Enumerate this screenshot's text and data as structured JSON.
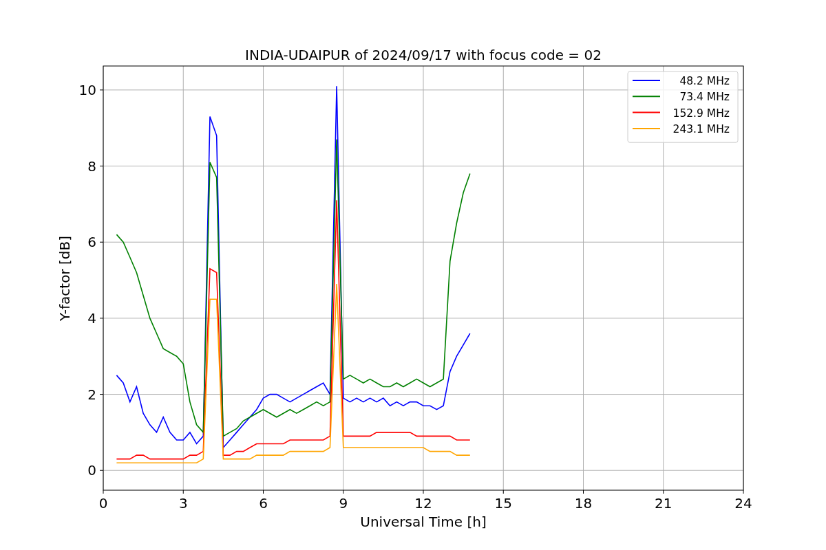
{
  "figure": {
    "chart_data": {
      "type": "line",
      "title": "INDIA-UDAIPUR of 2024/09/17 with focus code = 02",
      "xlabel": "Universal Time [h]",
      "ylabel": "Y-factor [dB]",
      "x": [
        0.5,
        0.75,
        1,
        1.25,
        1.5,
        1.75,
        2,
        2.25,
        2.5,
        2.75,
        3,
        3.25,
        3.5,
        3.75,
        4,
        4.25,
        4.5,
        4.75,
        5,
        5.25,
        5.5,
        5.75,
        6,
        6.25,
        6.5,
        6.75,
        7,
        7.25,
        7.5,
        7.75,
        8,
        8.25,
        8.5,
        8.75,
        9,
        9.25,
        9.5,
        9.75,
        10,
        10.25,
        10.5,
        10.75,
        11,
        11.25,
        11.5,
        11.75,
        12,
        12.25,
        12.5,
        12.75,
        13,
        13.25,
        13.5,
        13.75
      ],
      "series": [
        {
          "name": "48.2 MHz",
          "color": "#0000ff",
          "values": [
            2.5,
            2.3,
            1.8,
            2.2,
            1.5,
            1.2,
            1.0,
            1.4,
            1.0,
            0.8,
            0.8,
            1.0,
            0.7,
            0.9,
            9.3,
            8.8,
            0.6,
            0.8,
            1.0,
            1.2,
            1.4,
            1.6,
            1.9,
            2.0,
            2.0,
            1.9,
            1.8,
            1.9,
            2.0,
            2.1,
            2.2,
            2.3,
            2.0,
            10.1,
            1.9,
            1.8,
            1.9,
            1.8,
            1.9,
            1.8,
            1.9,
            1.7,
            1.8,
            1.7,
            1.8,
            1.8,
            1.7,
            1.7,
            1.6,
            1.7,
            2.6,
            3.0,
            3.3,
            3.6
          ]
        },
        {
          "name": "73.4 MHz",
          "color": "#008000",
          "values": [
            6.2,
            6.0,
            5.6,
            5.2,
            4.6,
            4.0,
            3.6,
            3.2,
            3.1,
            3.0,
            2.8,
            1.8,
            1.2,
            1.0,
            8.1,
            7.7,
            0.9,
            1.0,
            1.1,
            1.3,
            1.4,
            1.5,
            1.6,
            1.5,
            1.4,
            1.5,
            1.6,
            1.5,
            1.6,
            1.7,
            1.8,
            1.7,
            1.8,
            8.7,
            2.4,
            2.5,
            2.4,
            2.3,
            2.4,
            2.3,
            2.2,
            2.2,
            2.3,
            2.2,
            2.3,
            2.4,
            2.3,
            2.2,
            2.3,
            2.4,
            5.5,
            6.5,
            7.3,
            7.8
          ]
        },
        {
          "name": "152.9 MHz",
          "color": "#ff0000",
          "values": [
            0.3,
            0.3,
            0.3,
            0.4,
            0.4,
            0.3,
            0.3,
            0.3,
            0.3,
            0.3,
            0.3,
            0.4,
            0.4,
            0.5,
            5.3,
            5.2,
            0.4,
            0.4,
            0.5,
            0.5,
            0.6,
            0.7,
            0.7,
            0.7,
            0.7,
            0.7,
            0.8,
            0.8,
            0.8,
            0.8,
            0.8,
            0.8,
            0.9,
            7.1,
            0.9,
            0.9,
            0.9,
            0.9,
            0.9,
            1.0,
            1.0,
            1.0,
            1.0,
            1.0,
            1.0,
            0.9,
            0.9,
            0.9,
            0.9,
            0.9,
            0.9,
            0.8,
            0.8,
            0.8
          ]
        },
        {
          "name": "243.1 MHz",
          "color": "#ffa500",
          "values": [
            0.2,
            0.2,
            0.2,
            0.2,
            0.2,
            0.2,
            0.2,
            0.2,
            0.2,
            0.2,
            0.2,
            0.2,
            0.2,
            0.3,
            4.5,
            4.5,
            0.3,
            0.3,
            0.3,
            0.3,
            0.3,
            0.4,
            0.4,
            0.4,
            0.4,
            0.4,
            0.5,
            0.5,
            0.5,
            0.5,
            0.5,
            0.5,
            0.6,
            4.9,
            0.6,
            0.6,
            0.6,
            0.6,
            0.6,
            0.6,
            0.6,
            0.6,
            0.6,
            0.6,
            0.6,
            0.6,
            0.6,
            0.5,
            0.5,
            0.5,
            0.5,
            0.4,
            0.4,
            0.4
          ]
        }
      ],
      "xlim": [
        0,
        24
      ],
      "ylim": [
        -0.52,
        10.63
      ],
      "xticks": [
        0,
        3,
        6,
        9,
        12,
        15,
        18,
        21,
        24
      ],
      "yticks": [
        0,
        2,
        4,
        6,
        8,
        10
      ],
      "grid": true,
      "legend": "upper right"
    }
  }
}
